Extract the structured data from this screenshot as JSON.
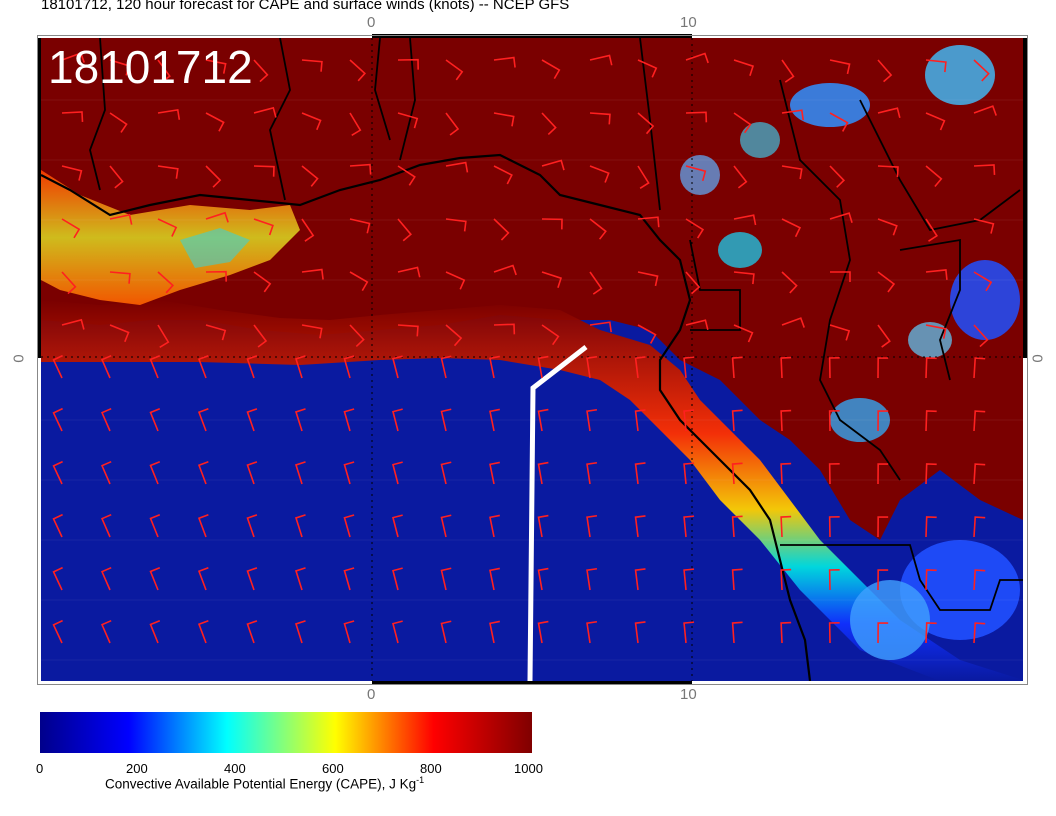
{
  "title": "18101712, 120 hour forecast for CAPE and surface winds (knots) -- NCEP GFS",
  "stamp": "18101712",
  "axis_ticks": {
    "top": [
      "0",
      "10"
    ],
    "bottom": [
      "0",
      "10"
    ],
    "left": "0",
    "right": "0"
  },
  "colorbar": {
    "ticks": [
      "0",
      "200",
      "400",
      "600",
      "800",
      "1000"
    ],
    "label": "Convective Available Potential Energy (CAPE), J Kg",
    "label_unit_exp": "-1",
    "colors": [
      "#00008b",
      "#0000ff",
      "#00ffff",
      "#ffff00",
      "#ff0000",
      "#800000"
    ]
  },
  "colors": {
    "low_cape": "#0a1aa0",
    "high_cape": "#7a0000",
    "wind_barbs": "#ff2020",
    "coastline": "#000000",
    "track_line": "#ffffff"
  }
}
